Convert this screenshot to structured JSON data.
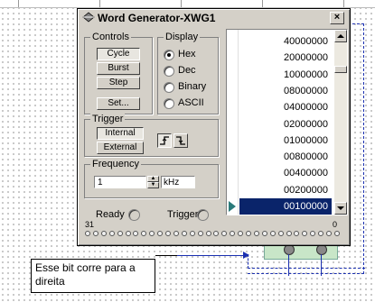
{
  "window": {
    "title": "Word Generator-XWG1",
    "close_glyph": "×"
  },
  "controls": {
    "label": "Controls",
    "cycle": "Cycle",
    "burst": "Burst",
    "step": "Step",
    "set": "Set..."
  },
  "display": {
    "label": "Display",
    "options": [
      "Hex",
      "Dec",
      "Binary",
      "ASCII"
    ],
    "selected": "Hex"
  },
  "trigger": {
    "label": "Trigger",
    "internal": "Internal",
    "external": "External",
    "rising_edge_icon": "rising-edge-icon",
    "falling_edge_icon": "falling-edge-icon"
  },
  "frequency": {
    "label": "Frequency",
    "value": "1",
    "unit": "kHz"
  },
  "status": {
    "ready": "Ready",
    "trigger": "Trigger",
    "bit_high": "31",
    "bit_low": "0"
  },
  "words": [
    "40000000",
    "20000000",
    "10000000",
    "08000000",
    "04000000",
    "02000000",
    "01000000",
    "00800000",
    "00400000",
    "00200000",
    "00100000"
  ],
  "selected_word_index": 10,
  "callout": {
    "text": "Esse bit corre para a direita"
  },
  "colors": {
    "selection": "#0a246a",
    "wire": "#1a2fb0",
    "output_box": "#c8e6c8"
  }
}
